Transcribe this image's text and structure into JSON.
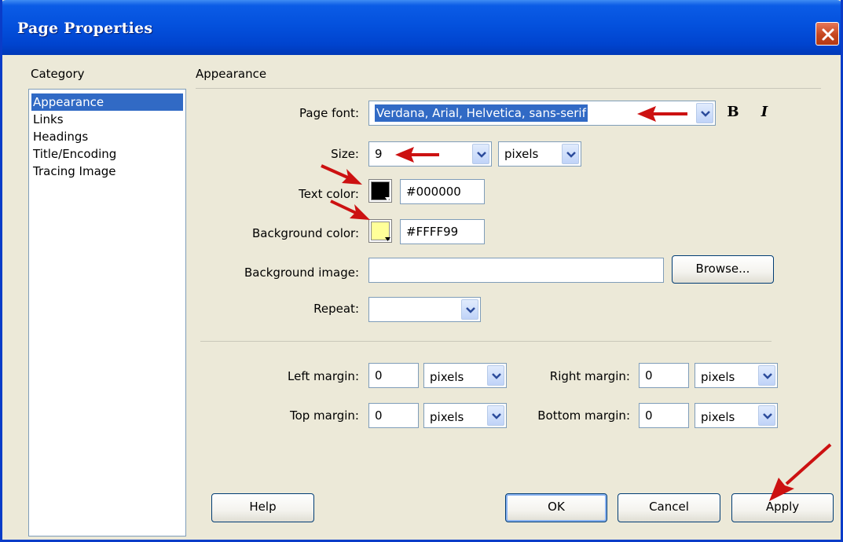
{
  "window": {
    "title": "Page Properties"
  },
  "category": {
    "label": "Category",
    "items": [
      "Appearance",
      "Links",
      "Headings",
      "Title/Encoding",
      "Tracing Image"
    ],
    "selected": "Appearance"
  },
  "section": {
    "title": "Appearance"
  },
  "page_font": {
    "label": "Page font:",
    "value": "Verdana, Arial, Helvetica, sans-serif",
    "bold": "B",
    "italic": "I"
  },
  "size": {
    "label": "Size:",
    "value": "9",
    "unit": "pixels"
  },
  "text_color": {
    "label": "Text color:",
    "value": "#000000",
    "swatch": "#000000"
  },
  "background_color": {
    "label": "Background color:",
    "value": "#FFFF99",
    "swatch": "#FFFF99"
  },
  "background_image": {
    "label": "Background image:",
    "value": "",
    "browse": "Browse..."
  },
  "repeat": {
    "label": "Repeat:",
    "value": ""
  },
  "margins": {
    "left": {
      "label": "Left margin:",
      "value": "0",
      "unit": "pixels"
    },
    "right": {
      "label": "Right margin:",
      "value": "0",
      "unit": "pixels"
    },
    "top": {
      "label": "Top margin:",
      "value": "0",
      "unit": "pixels"
    },
    "bottom": {
      "label": "Bottom margin:",
      "value": "0",
      "unit": "pixels"
    }
  },
  "buttons": {
    "help": "Help",
    "ok": "OK",
    "cancel": "Cancel",
    "apply": "Apply"
  },
  "colors": {
    "annotation_arrow": "#cc1111",
    "selection": "#316ac5",
    "title_bar": "#0451dd"
  }
}
